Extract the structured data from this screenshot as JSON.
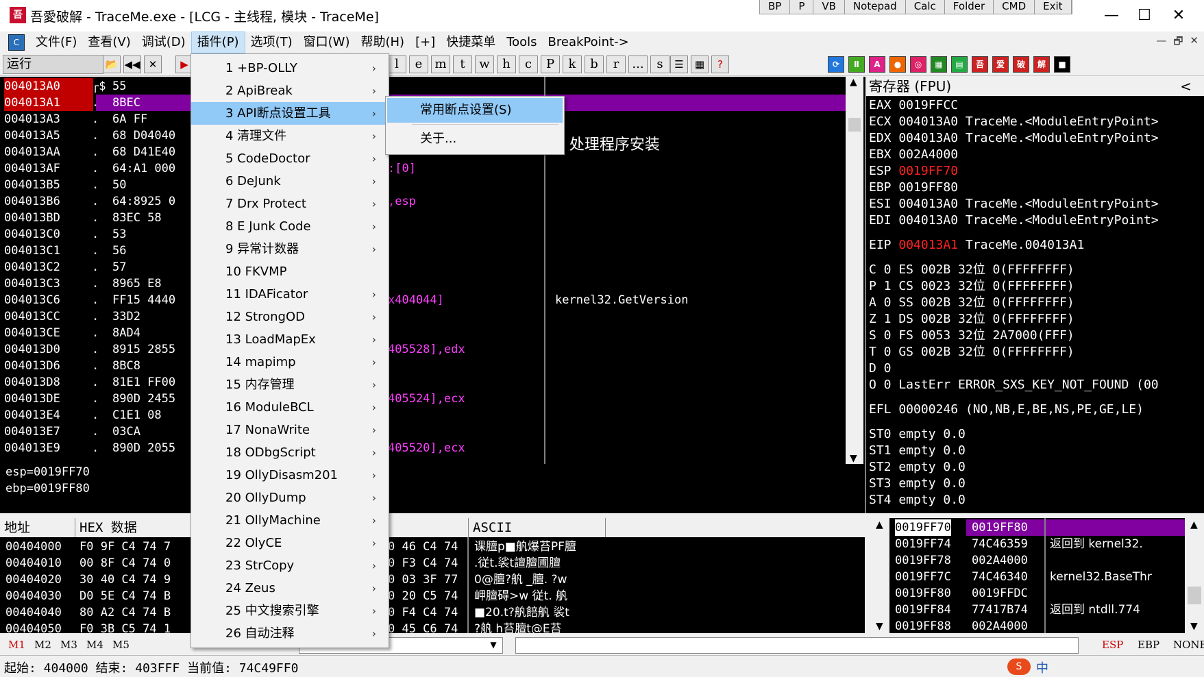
{
  "window": {
    "title": "吾愛破解 - TraceMe.exe - [LCG - 主线程, 模块 - TraceMe]",
    "app_icon_text": "吾",
    "quick_buttons": [
      "BP",
      "P",
      "VB",
      "Notepad",
      "Calc",
      "Folder",
      "CMD",
      "Exit"
    ],
    "controls": [
      "—",
      "☐",
      "✕"
    ]
  },
  "menubar": {
    "items": [
      "文件(F)",
      "查看(V)",
      "调试(D)",
      "插件(P)",
      "选项(T)",
      "窗口(W)",
      "帮助(H)",
      "[+]",
      "快捷菜单",
      "Tools",
      "BreakPoint->"
    ],
    "mdi_icon": "C",
    "mdi_controls": [
      "—",
      "🗗",
      "✕"
    ]
  },
  "toolbar": {
    "status": "运行",
    "letters": [
      "l",
      "e",
      "m",
      "t",
      "w",
      "h",
      "c",
      "P",
      "k",
      "b",
      "r",
      "...",
      "s"
    ],
    "icons": [
      "open-icon",
      "rewind-icon",
      "close-icon",
      "play-icon",
      "list-icon",
      "grid-icon",
      "help-icon"
    ],
    "help_glyph": "?",
    "right_icons": [
      "⟳",
      "Ⅱ",
      "A",
      "●",
      "◎",
      "▦",
      "▤",
      "吾",
      "爱",
      "破",
      "解",
      "■"
    ]
  },
  "cpu": {
    "rows": [
      {
        "addr": "004013A0",
        "mark": "┌$",
        "hex": "55"
      },
      {
        "addr": "004013A1",
        "mark": ".",
        "hex": "8BEC"
      },
      {
        "addr": "004013A3",
        "mark": ".",
        "hex": "6A FF"
      },
      {
        "addr": "004013A5",
        "mark": ".",
        "hex": "68 D04040"
      },
      {
        "addr": "004013AA",
        "mark": ".",
        "hex": "68 D41E40"
      },
      {
        "addr": "004013AF",
        "mark": ".",
        "hex": "64:A1 000"
      },
      {
        "addr": "004013B5",
        "mark": ".",
        "hex": "50"
      },
      {
        "addr": "004013B6",
        "mark": ".",
        "hex": "64:8925 0"
      },
      {
        "addr": "004013BD",
        "mark": ".",
        "hex": "83EC 58"
      },
      {
        "addr": "004013C0",
        "mark": ".",
        "hex": "53"
      },
      {
        "addr": "004013C1",
        "mark": ".",
        "hex": "56"
      },
      {
        "addr": "004013C2",
        "mark": ".",
        "hex": "57"
      },
      {
        "addr": "004013C3",
        "mark": ".",
        "hex": "8965 E8"
      },
      {
        "addr": "004013C6",
        "mark": ".",
        "hex": "FF15 4440"
      },
      {
        "addr": "004013CC",
        "mark": ".",
        "hex": "33D2"
      },
      {
        "addr": "004013CE",
        "mark": ".",
        "hex": "8AD4"
      },
      {
        "addr": "004013D0",
        "mark": ".",
        "hex": "8915 2855"
      },
      {
        "addr": "004013D6",
        "mark": ".",
        "hex": "8BC8"
      },
      {
        "addr": "004013D8",
        "mark": ".",
        "hex": "81E1 FF00"
      },
      {
        "addr": "004013DE",
        "mark": ".",
        "hex": "890D 2455"
      },
      {
        "addr": "004013E4",
        "mark": ".",
        "hex": "C1E1 08"
      },
      {
        "addr": "004013E7",
        "mark": ".",
        "hex": "03CA"
      },
      {
        "addr": "004013E9",
        "mark": ".",
        "hex": "890D 2055"
      }
    ],
    "disasm_fragments": [
      {
        "text": ":[0]",
        "color": "#ff40ff",
        "row": 5
      },
      {
        "text": ",esp",
        "color": "#ff40ff",
        "row": 7
      },
      {
        "text": "x404044]",
        "color": "#ff40ff",
        "row": 13
      },
      {
        "text": "405528],edx",
        "color": "#ff40ff",
        "row": 16
      },
      {
        "text": "405524],ecx",
        "color": "#ff40ff",
        "row": 19
      },
      {
        "text": "405520],ecx",
        "color": "#ff40ff",
        "row": 22
      }
    ],
    "comments": [
      {
        "text": "E 处理程序安装",
        "row": 4
      },
      {
        "text": "kernel32.GetVersion",
        "row": 13
      }
    ]
  },
  "registers": {
    "header": "寄存器 (FPU)",
    "collapse": "<",
    "lines": [
      {
        "text": "EAX 0019FFCC"
      },
      {
        "text": "ECX 004013A0 TraceMe.<ModuleEntryPoint>"
      },
      {
        "text": "EDX 004013A0 TraceMe.<ModuleEntryPoint>"
      },
      {
        "text": "EBX 002A4000"
      },
      {
        "name": "ESP",
        "value": "0019FF70",
        "red": true
      },
      {
        "text": "EBP 0019FF80"
      },
      {
        "text": "ESI 004013A0 TraceMe.<ModuleEntryPoint>"
      },
      {
        "text": "EDI 004013A0 TraceMe.<ModuleEntryPoint>"
      },
      {
        "gap": true
      },
      {
        "name": "EIP",
        "value": "004013A1",
        "red": true,
        "suffix": "TraceMe.004013A1"
      },
      {
        "gap": true
      },
      {
        "text": "C 0  ES 002B 32位  0(FFFFFFFF)"
      },
      {
        "text": "P 1  CS 0023 32位  0(FFFFFFFF)"
      },
      {
        "text": "A 0  SS 002B 32位  0(FFFFFFFF)"
      },
      {
        "text": "Z 1  DS 002B 32位  0(FFFFFFFF)"
      },
      {
        "text": "S 0  FS 0053 32位  2A7000(FFF)"
      },
      {
        "text": "T 0  GS 002B 32位  0(FFFFFFFF)"
      },
      {
        "text": "D 0"
      },
      {
        "text": "O 0  LastErr ERROR_SXS_KEY_NOT_FOUND (00"
      },
      {
        "gap": true
      },
      {
        "text": "EFL 00000246 (NO,NB,E,BE,NS,PE,GE,LE)"
      },
      {
        "gap": true
      },
      {
        "text": "ST0 empty 0.0"
      },
      {
        "text": "ST1 empty 0.0"
      },
      {
        "text": "ST2 empty 0.0"
      },
      {
        "text": "ST3 empty 0.0"
      },
      {
        "text": "ST4 empty 0.0"
      }
    ]
  },
  "info": {
    "lines": [
      "esp=0019FF70",
      "ebp=0019FF80"
    ]
  },
  "dump": {
    "headers": {
      "addr": "地址",
      "hex": "HEX 数据",
      "ascii": "ASCII"
    },
    "rows": [
      {
        "addr": "00404000",
        "hex": "F0 9F C4 74 7",
        "hex_tail": "0 46 C4 74",
        "ascii": "课膻p■舧爆苔PF膻"
      },
      {
        "addr": "00404010",
        "hex": "00 8F C4 74 0",
        "hex_tail": "0 F3 C4 74",
        "ascii": ".従t.裟t譠膻圃膻"
      },
      {
        "addr": "00404020",
        "hex": "30 40 C4 74 9",
        "hex_tail": "0 03 3F 77",
        "ascii": "0@膻?舧 _膻. ?w"
      },
      {
        "addr": "00404030",
        "hex": "D0 5E C4 74 B",
        "hex_tail": "0 20 C5 74",
        "ascii": "岬膻碍>w 従t. 舧"
      },
      {
        "addr": "00404040",
        "hex": "80 A2 C4 74 B",
        "hex_tail": "0 F4 C4 74",
        "ascii": "■20.t?舧餢舧 裟t"
      },
      {
        "addr": "00404050",
        "hex": "F0 3B C5 74 1",
        "hex_tail": "0 45 C6 74",
        "ascii": "?舧 h苔膻t@E苔"
      }
    ]
  },
  "stack": {
    "rows": [
      {
        "addr": "0019FF70",
        "val": "0019FF80",
        "comment": "",
        "selected": true
      },
      {
        "addr": "0019FF74",
        "val": "74C46359",
        "comment": "返回到 kernel32."
      },
      {
        "addr": "0019FF78",
        "val": "002A4000",
        "comment": ""
      },
      {
        "addr": "0019FF7C",
        "val": "74C46340",
        "comment": "kernel32.BaseThr"
      },
      {
        "addr": "0019FF80",
        "val": "0019FFDC",
        "comment": ""
      },
      {
        "addr": "0019FF84",
        "val": "77417B74",
        "comment": "返回到 ntdll.774"
      },
      {
        "addr": "0019FF88",
        "val": "002A4000",
        "comment": ""
      }
    ]
  },
  "command": {
    "mbuttons": [
      "M1",
      "M2",
      "M3",
      "M4",
      "M5"
    ],
    "label": "Command:",
    "dropdown": "▼",
    "right": [
      "ESP",
      "EBP",
      "NONE"
    ]
  },
  "status": {
    "text": "起始: 404000 结束: 403FFF 当前值: 74C49FF0"
  },
  "plugin_menu": {
    "items": [
      {
        "label": "1 +BP-OLLY",
        "arrow": true
      },
      {
        "label": "2 ApiBreak",
        "arrow": true
      },
      {
        "label": "3 API断点设置工具",
        "arrow": true,
        "hot": true
      },
      {
        "label": "4 清理文件",
        "arrow": true
      },
      {
        "label": "5 CodeDoctor",
        "arrow": true
      },
      {
        "label": "6 DeJunk",
        "arrow": true
      },
      {
        "label": "7 Drx Protect",
        "arrow": true
      },
      {
        "label": "8 E Junk Code",
        "arrow": true
      },
      {
        "label": "9 异常计数器",
        "arrow": true
      },
      {
        "label": "10 FKVMP",
        "arrow": false
      },
      {
        "label": "11 IDAFicator",
        "arrow": true
      },
      {
        "label": "12 StrongOD",
        "arrow": true
      },
      {
        "label": "13 LoadMapEx",
        "arrow": true
      },
      {
        "label": "14 mapimp",
        "arrow": true
      },
      {
        "label": "15 内存管理",
        "arrow": true
      },
      {
        "label": "16 ModuleBCL",
        "arrow": true
      },
      {
        "label": "17 NonaWrite",
        "arrow": true
      },
      {
        "label": "18 ODbgScript",
        "arrow": true
      },
      {
        "label": "19 OllyDisasm201",
        "arrow": true
      },
      {
        "label": "20 OllyDump",
        "arrow": true
      },
      {
        "label": "21 OllyMachine",
        "arrow": true
      },
      {
        "label": "22 OlyCE",
        "arrow": true
      },
      {
        "label": "23 StrCopy",
        "arrow": true
      },
      {
        "label": "24 Zeus",
        "arrow": true
      },
      {
        "label": "25 中文搜索引擎",
        "arrow": true
      },
      {
        "label": "26 自动注释",
        "arrow": true
      }
    ],
    "arrow_glyph": "›"
  },
  "sub_menu": {
    "items": [
      {
        "label": "常用断点设置(S)",
        "hot": true
      },
      {
        "label": "关于..."
      }
    ]
  },
  "tray": {
    "text": "中"
  }
}
